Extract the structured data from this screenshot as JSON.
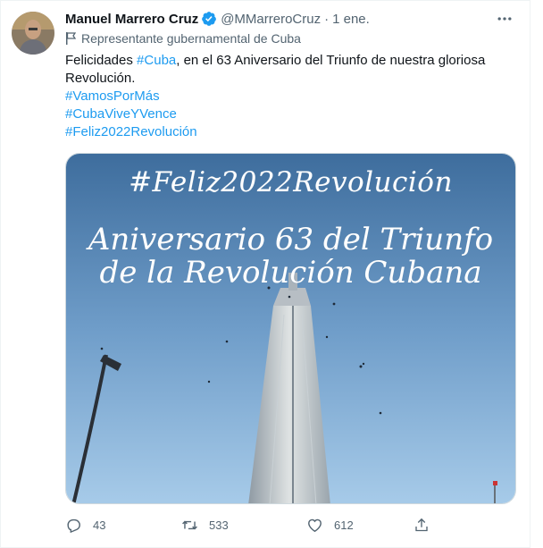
{
  "tweet": {
    "author_name": "Manuel Marrero Cruz",
    "handle": "@MMarreroCruz",
    "separator": "·",
    "time": "1 ene.",
    "label": "Representante gubernamental de Cuba",
    "text_prefix": "Felicidades ",
    "text_hashtag": "#Cuba",
    "text_suffix": ", en el 63 Aniversario del Triunfo de nuestra gloriosa Revolución.",
    "hashtags": [
      "#VamosPorMás",
      "#CubaViveYVence",
      "#Feliz2022Revolución"
    ],
    "more_icon": "more-horizontal-icon",
    "verified_icon": "verified-badge-icon",
    "flag_icon": "government-flag-icon"
  },
  "media": {
    "line1": "#Feliz2022Revolución",
    "line2": "Aniversario 63 del Triunfo",
    "line3": "de la Revolución Cubana"
  },
  "actions": {
    "reply_count": "43",
    "retweet_count": "533",
    "like_count": "612",
    "reply_icon": "reply-icon",
    "retweet_icon": "retweet-icon",
    "like_icon": "heart-icon",
    "share_icon": "share-icon"
  },
  "colors": {
    "accent": "#1d9bf0",
    "secondary_text": "#536471",
    "primary_text": "#0f1419",
    "sky_top": "#3f6fa0",
    "sky_bottom": "#9fc4e6"
  }
}
